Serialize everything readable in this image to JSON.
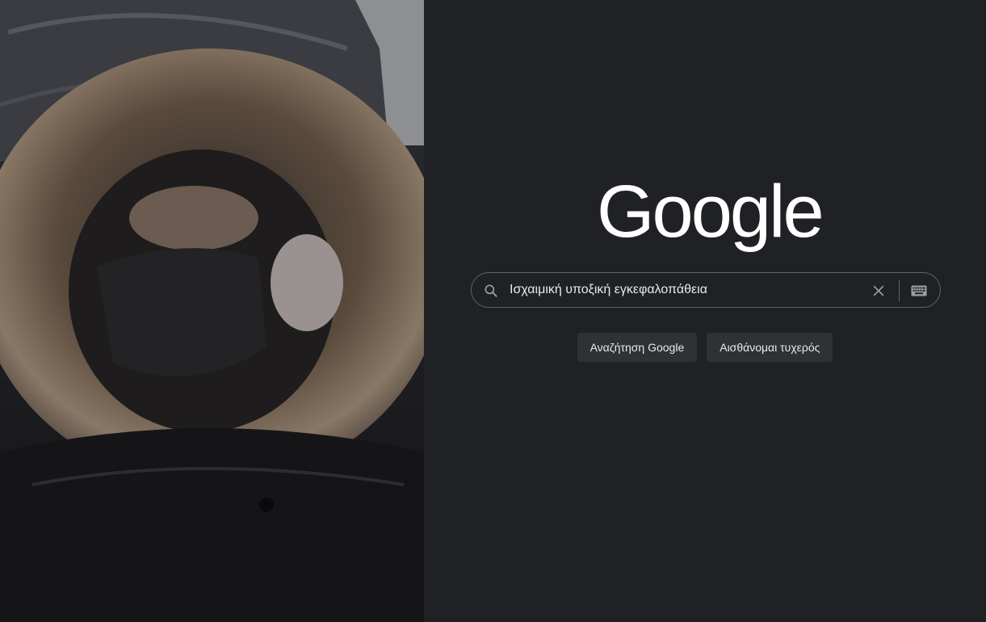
{
  "logo": {
    "text": "Google"
  },
  "search": {
    "query": "Ισχαιμική υποξική εγκεφαλοπάθεια",
    "search_icon": "search-icon",
    "clear_icon": "close-icon",
    "keyboard_icon": "keyboard-icon"
  },
  "buttons": {
    "search_label": "Αναζήτηση Google",
    "lucky_label": "Αισθάνομαι τυχερός"
  },
  "colors": {
    "background": "#202124",
    "text": "#e8eaed",
    "button_bg": "#303134",
    "border": "#5f6368"
  }
}
